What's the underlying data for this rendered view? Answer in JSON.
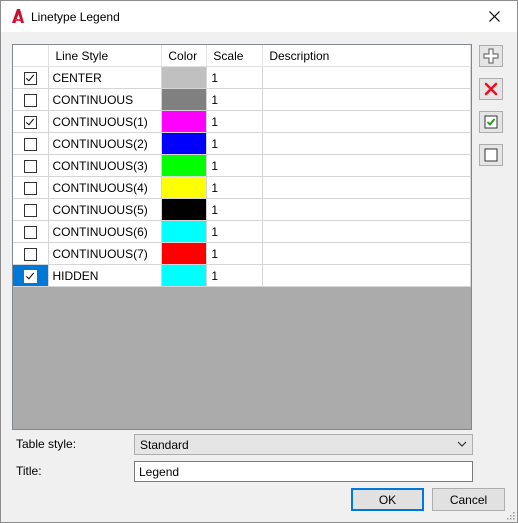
{
  "window": {
    "title": "Linetype Legend",
    "app_icon": "autocad-a-icon"
  },
  "table": {
    "columns": {
      "check": "",
      "line_style": "Line Style",
      "color": "Color",
      "scale": "Scale",
      "description": "Description"
    },
    "rows": [
      {
        "checked": true,
        "name": "CENTER",
        "color": "#c0c0c0",
        "scale": "1",
        "description": "",
        "selected": false
      },
      {
        "checked": false,
        "name": "CONTINUOUS",
        "color": "#808080",
        "scale": "1",
        "description": "",
        "selected": false
      },
      {
        "checked": true,
        "name": "CONTINUOUS(1)",
        "color": "#ff00ff",
        "scale": "1",
        "description": "",
        "selected": false
      },
      {
        "checked": false,
        "name": "CONTINUOUS(2)",
        "color": "#0000ff",
        "scale": "1",
        "description": "",
        "selected": false
      },
      {
        "checked": false,
        "name": "CONTINUOUS(3)",
        "color": "#00ff00",
        "scale": "1",
        "description": "",
        "selected": false
      },
      {
        "checked": false,
        "name": "CONTINUOUS(4)",
        "color": "#ffff00",
        "scale": "1",
        "description": "",
        "selected": false
      },
      {
        "checked": false,
        "name": "CONTINUOUS(5)",
        "color": "#000000",
        "scale": "1",
        "description": "",
        "selected": false
      },
      {
        "checked": false,
        "name": "CONTINUOUS(6)",
        "color": "#00ffff",
        "scale": "1",
        "description": "",
        "selected": false
      },
      {
        "checked": false,
        "name": "CONTINUOUS(7)",
        "color": "#ff0000",
        "scale": "1",
        "description": "",
        "selected": false
      },
      {
        "checked": true,
        "name": "HIDDEN",
        "color": "#00ffff",
        "scale": "1",
        "description": "",
        "selected": true
      }
    ]
  },
  "side_buttons": [
    {
      "name": "add-button",
      "icon": "plus-icon"
    },
    {
      "name": "delete-button",
      "icon": "red-x-icon"
    },
    {
      "name": "check-all-button",
      "icon": "checked-box-icon"
    },
    {
      "name": "uncheck-all-button",
      "icon": "empty-box-icon"
    }
  ],
  "form": {
    "table_style_label": "Table style:",
    "table_style_value": "Standard",
    "title_label": "Title:",
    "title_value": "Legend"
  },
  "buttons": {
    "ok": "OK",
    "cancel": "Cancel"
  },
  "colors": {
    "accent": "#0078d7",
    "table_background": "#ababab"
  }
}
